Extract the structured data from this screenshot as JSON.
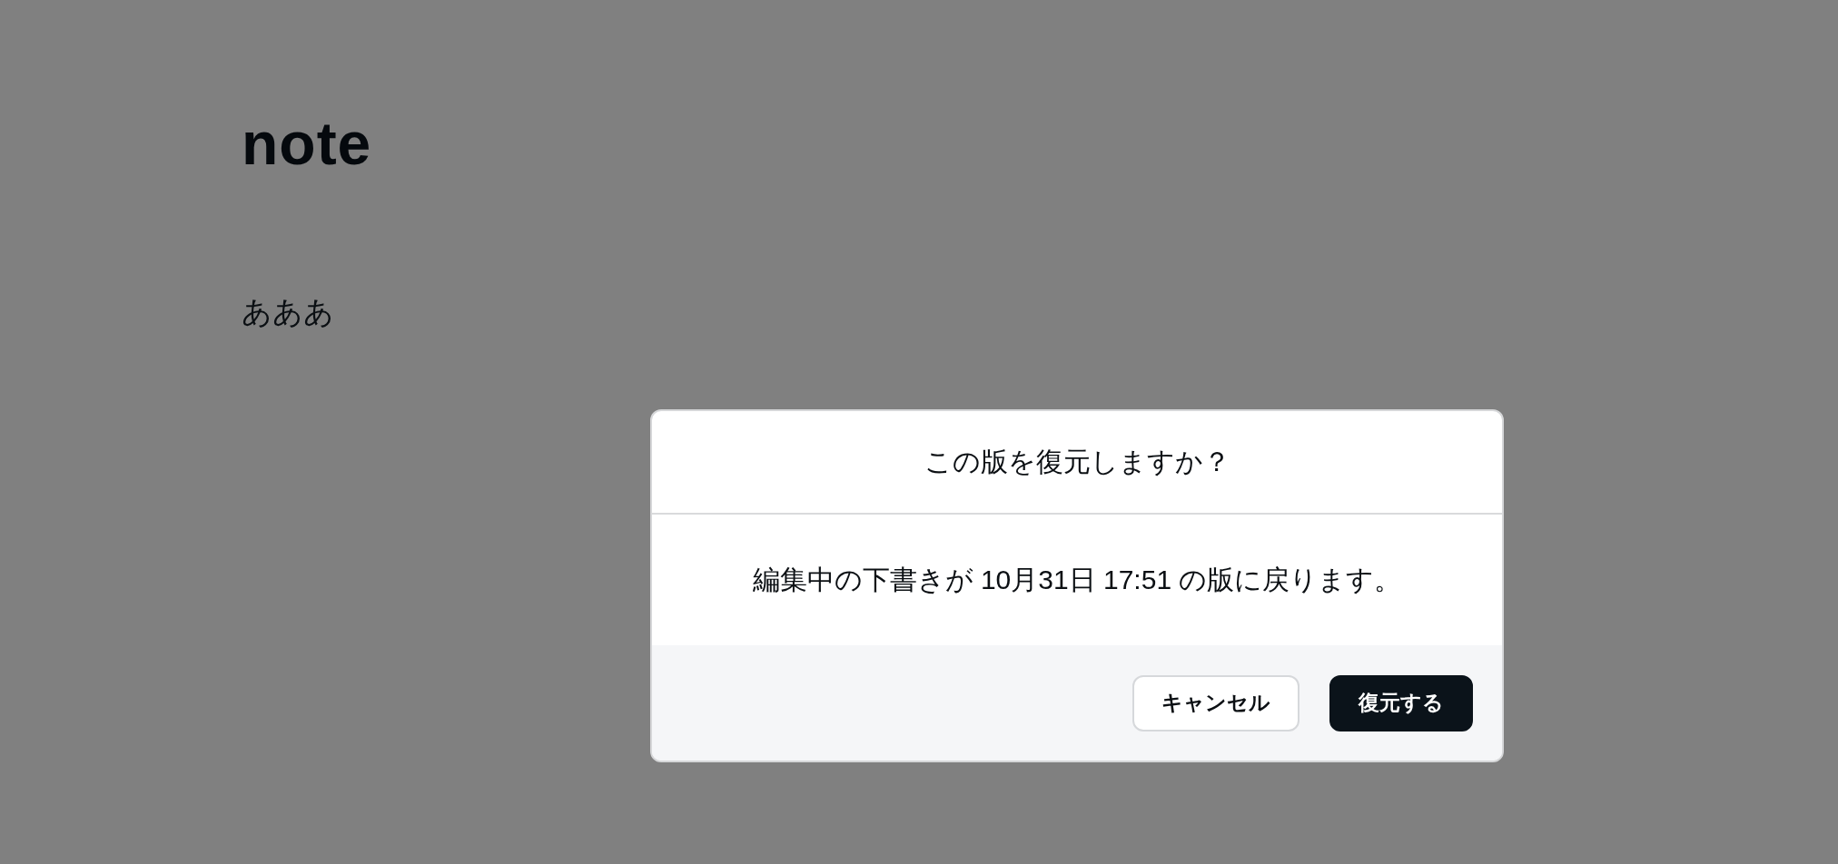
{
  "logo": {
    "text": "note"
  },
  "page": {
    "body": "あああ"
  },
  "dialog": {
    "title": "この版を復元しますか？",
    "message": "編集中の下書きが 10月31日 17:51 の版に戻ります。",
    "buttons": [
      {
        "label": "キャンセル",
        "kind": "secondary"
      },
      {
        "label": "復元する",
        "kind": "primary"
      }
    ]
  }
}
